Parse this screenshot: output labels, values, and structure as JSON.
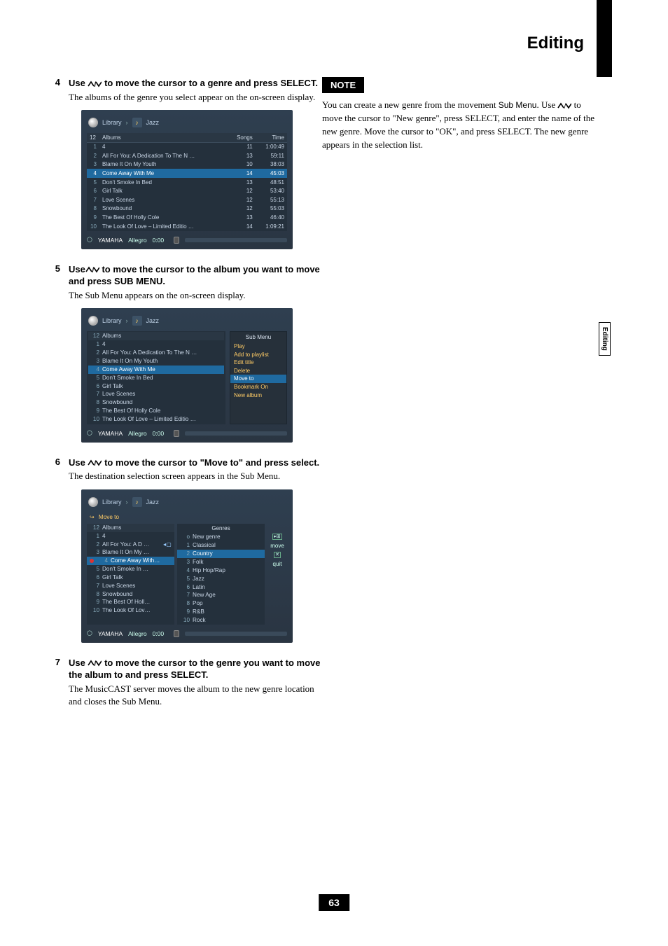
{
  "page_title": "Editing",
  "side_tab": "Editing",
  "page_number": "63",
  "note_badge": "NOTE",
  "note_text_before_submenu": "You can create a new genre from the movement ",
  "note_submenu": "Sub Menu",
  "note_text_mid": ". Use ",
  "note_text_after_arrows": " to move the cursor to \"New genre\", press SELECT, and enter the name of the new genre. Move the cursor to \"OK\", and press SELECT. The new genre appears in the selection list.",
  "steps": {
    "s4": {
      "num": "4",
      "title_before": "Use ",
      "title_after": " to move the cursor to a genre and press SELECT.",
      "desc": "The albums of the genre you select appear on the on-screen display."
    },
    "s5": {
      "num": "5",
      "title_before": "Use",
      "title_after": " to move the cursor to the album you want to move and press SUB MENU.",
      "desc": "The Sub Menu appears on the on-screen display."
    },
    "s6": {
      "num": "6",
      "title_before": "Use ",
      "title_after": " to move the cursor to \"Move to\" and press select.",
      "desc": "The destination selection screen appears in the Sub Menu."
    },
    "s7": {
      "num": "7",
      "title_before": "Use ",
      "title_after": " to move the cursor to the genre you want to move the album to and press SELECT.",
      "desc": "The MusicCAST server moves the album to the new genre location and closes the Sub Menu."
    }
  },
  "screen1": {
    "crumb_library": "Library",
    "crumb_genre": "Jazz",
    "header_count": "12",
    "header_albums": "Albums",
    "header_songs": "Songs",
    "header_time": "Time",
    "rows": [
      {
        "n": "1",
        "title": "4",
        "songs": "11",
        "time": "1:00:49"
      },
      {
        "n": "2",
        "title": "All For You: A Dedication To The N …",
        "songs": "13",
        "time": "59:11"
      },
      {
        "n": "3",
        "title": "Blame It On My Youth",
        "songs": "10",
        "time": "38:03"
      },
      {
        "n": "4",
        "title": "Come Away With Me",
        "songs": "14",
        "time": "45:03",
        "hl": true
      },
      {
        "n": "5",
        "title": "Don't Smoke In Bed",
        "songs": "13",
        "time": "48:51"
      },
      {
        "n": "6",
        "title": "Girl Talk",
        "songs": "12",
        "time": "53:40"
      },
      {
        "n": "7",
        "title": "Love Scenes",
        "songs": "12",
        "time": "55:13"
      },
      {
        "n": "8",
        "title": "Snowbound",
        "songs": "12",
        "time": "55:03"
      },
      {
        "n": "9",
        "title": "The Best Of Holly Cole",
        "songs": "13",
        "time": "46:40"
      },
      {
        "n": "10",
        "title": "The Look Of Love – Limited Editio …",
        "songs": "14",
        "time": "1:09:21"
      }
    ],
    "footer_brand": "YAMAHA",
    "footer_mode": "Allegro",
    "footer_time": "0:00"
  },
  "screen2": {
    "crumb_library": "Library",
    "crumb_genre": "Jazz",
    "header_count": "12",
    "header_albums": "Albums",
    "rows": [
      {
        "n": "1",
        "title": "4"
      },
      {
        "n": "2",
        "title": "All For You: A Dedication To The N …"
      },
      {
        "n": "3",
        "title": "Blame It On My Youth"
      },
      {
        "n": "4",
        "title": "Come Away With Me",
        "hl": true
      },
      {
        "n": "5",
        "title": "Don't Smoke In Bed"
      },
      {
        "n": "6",
        "title": "Girl Talk"
      },
      {
        "n": "7",
        "title": "Love Scenes"
      },
      {
        "n": "8",
        "title": "Snowbound"
      },
      {
        "n": "9",
        "title": "The Best Of Holly Cole"
      },
      {
        "n": "10",
        "title": "The Look Of Love – Limited Editio …"
      }
    ],
    "submenu_title": "Sub Menu",
    "submenu_items": [
      {
        "label": "Play"
      },
      {
        "label": "Add to playlist"
      },
      {
        "label": "Edit title"
      },
      {
        "label": "Delete"
      },
      {
        "label": "Move to",
        "hl": true
      },
      {
        "label": "Bookmark On"
      },
      {
        "label": "New album"
      }
    ],
    "footer_brand": "YAMAHA",
    "footer_mode": "Allegro",
    "footer_time": "0:00"
  },
  "screen3": {
    "crumb_library": "Library",
    "crumb_genre": "Jazz",
    "moveto_label": "Move to",
    "left_header_count": "12",
    "left_header_albums": "Albums",
    "left_rows": [
      {
        "n": "1",
        "title": "4"
      },
      {
        "n": "2",
        "title": "All For You: A D …"
      },
      {
        "n": "3",
        "title": "Blame It On My …"
      },
      {
        "n": "4",
        "title": "Come Away With…",
        "hl": true
      },
      {
        "n": "5",
        "title": "Don't Smoke In …"
      },
      {
        "n": "6",
        "title": "Girl Talk"
      },
      {
        "n": "7",
        "title": "Love Scenes"
      },
      {
        "n": "8",
        "title": "Snowbound"
      },
      {
        "n": "9",
        "title": "The Best Of Holl…"
      },
      {
        "n": "10",
        "title": "The Look Of Lov…"
      }
    ],
    "right_header": "Genres",
    "right_rows": [
      {
        "n": "o",
        "title": "New genre"
      },
      {
        "n": "1",
        "title": "Classical"
      },
      {
        "n": "2",
        "title": "Country",
        "hl": true
      },
      {
        "n": "3",
        "title": "Folk"
      },
      {
        "n": "4",
        "title": "Hip Hop/Rap"
      },
      {
        "n": "5",
        "title": "Jazz"
      },
      {
        "n": "6",
        "title": "Latin"
      },
      {
        "n": "7",
        "title": "New Age"
      },
      {
        "n": "8",
        "title": "Pop"
      },
      {
        "n": "9",
        "title": "R&B"
      },
      {
        "n": "10",
        "title": "Rock"
      }
    ],
    "side_move": "move",
    "side_quit": "quit",
    "footer_brand": "YAMAHA",
    "footer_mode": "Allegro",
    "footer_time": "0:00"
  }
}
